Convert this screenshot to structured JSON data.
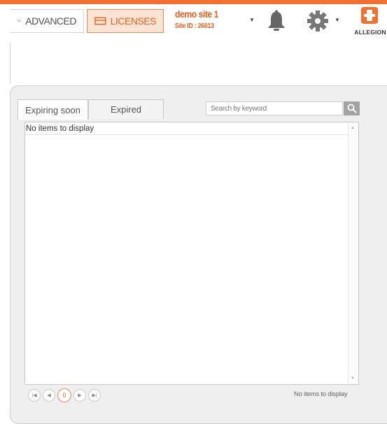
{
  "header": {
    "advanced_label": "ADVANCED",
    "licenses_label": "LICENSES",
    "site_name": "demo site 1",
    "site_id": "Site ID : 26013",
    "logo_text": "ALLEGION",
    "icons": {
      "advanced": "tools-icon",
      "licenses": "license-card-icon",
      "notifications": "bell-icon",
      "settings": "gear-icon",
      "logo": "allegion-logo-icon"
    }
  },
  "tabs": [
    {
      "label": "Expiring soon",
      "active": true
    },
    {
      "label": "Expired",
      "active": false
    }
  ],
  "search": {
    "placeholder": "Search by keyword",
    "value": ""
  },
  "grid": {
    "empty_message": "No items to display"
  },
  "pager": {
    "current_page": "0",
    "status": "No items to display"
  },
  "colors": {
    "accent": "#f07132",
    "accent_text": "#e8601c",
    "accent_bg": "#fde3d4"
  }
}
